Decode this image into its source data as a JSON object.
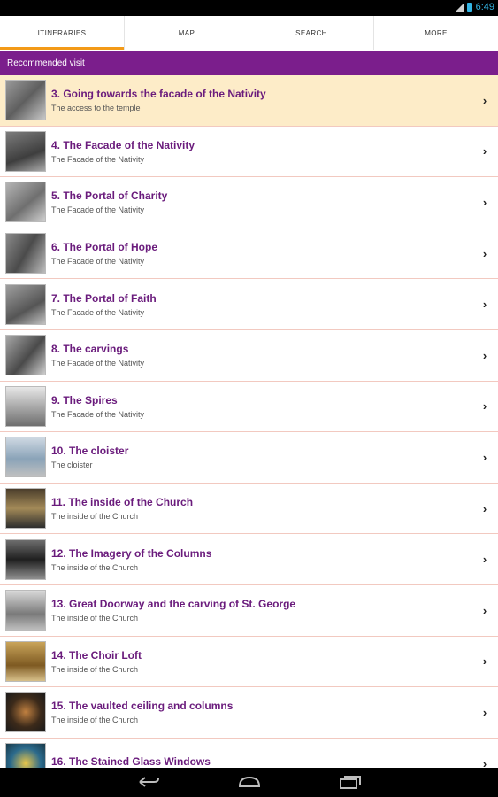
{
  "status": {
    "time": "6:49"
  },
  "tabs": [
    {
      "label": "ITINERARIES",
      "active": true
    },
    {
      "label": "MAP",
      "active": false
    },
    {
      "label": "SEARCH",
      "active": false
    },
    {
      "label": "MORE",
      "active": false
    }
  ],
  "section": {
    "title": "Recommended visit"
  },
  "items": [
    {
      "title": "3. Going towards the facade of the Nativity",
      "subtitle": "The access to the temple",
      "selected": true
    },
    {
      "title": "4. The Facade of the Nativity",
      "subtitle": "The Facade of the Nativity"
    },
    {
      "title": "5. The Portal of Charity",
      "subtitle": "The Facade of the Nativity"
    },
    {
      "title": "6. The Portal of Hope",
      "subtitle": "The Facade of the Nativity"
    },
    {
      "title": "7. The Portal of Faith",
      "subtitle": "The Facade of the Nativity"
    },
    {
      "title": "8. The carvings",
      "subtitle": "The Facade of the Nativity"
    },
    {
      "title": "9. The Spires",
      "subtitle": "The Facade of the Nativity"
    },
    {
      "title": "10. The cloister",
      "subtitle": "The cloister"
    },
    {
      "title": "11. The inside of the Church",
      "subtitle": "The inside of the Church"
    },
    {
      "title": "12. The Imagery of the Columns",
      "subtitle": "The inside of the Church"
    },
    {
      "title": "13. Great Doorway and the carving of St. George",
      "subtitle": "The inside of the Church"
    },
    {
      "title": "14. The Choir Loft",
      "subtitle": "The inside of the Church"
    },
    {
      "title": "15. The vaulted ceiling and columns",
      "subtitle": "The inside of the Church"
    },
    {
      "title": "16. The Stained Glass Windows",
      "subtitle": ""
    }
  ],
  "colors": {
    "accent": "#7b1e8c",
    "tab_indicator": "#f39a17",
    "selected_row": "#fdecc8"
  }
}
